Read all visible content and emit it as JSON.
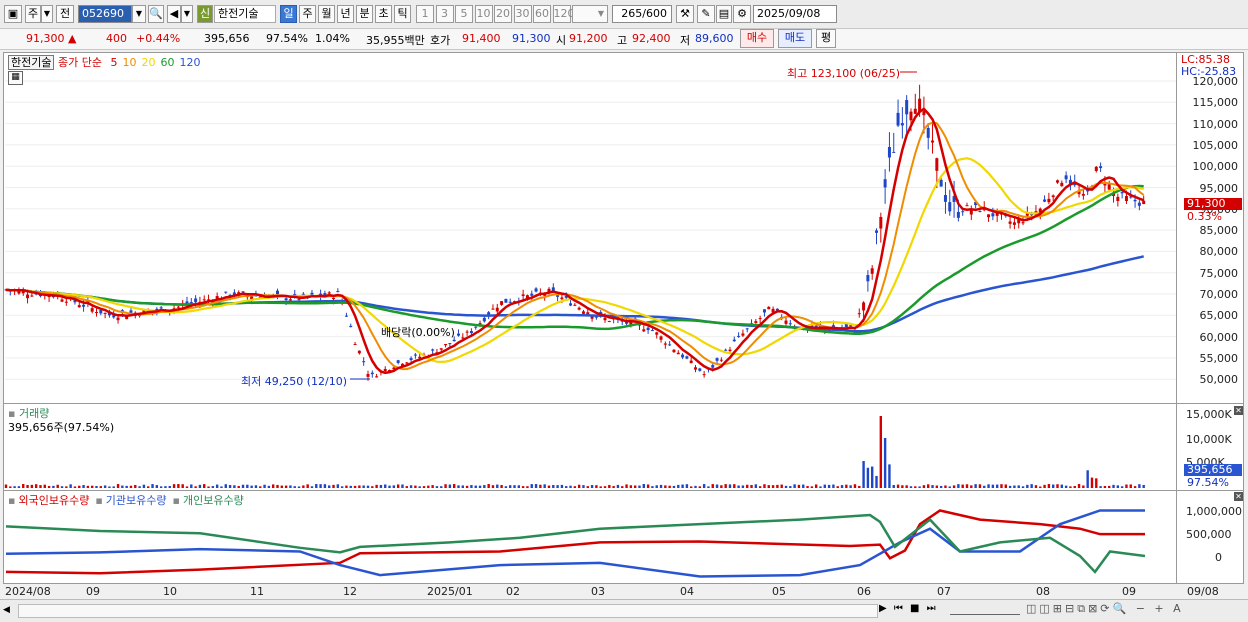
{
  "toolbar": {
    "market_btn": "주",
    "prev_btn": "전",
    "code": "052690",
    "credit_badge": "신",
    "stock_name": "한전기술",
    "periods": [
      "일",
      "주",
      "월",
      "년",
      "분",
      "초",
      "틱"
    ],
    "active_period": "일",
    "intervals": [
      "1",
      "3",
      "5",
      "10",
      "20",
      "30",
      "60",
      "120"
    ],
    "count": "265",
    "count_total": "/600",
    "date": "2025/09/08"
  },
  "quote": {
    "price": "91,300",
    "change": "400",
    "change_pct": "+0.44%",
    "volume": "395,656",
    "volume_ratio": "97.54%",
    "turnover_pct": "1.04%",
    "amount": "35,955백만",
    "ask_label": "호가",
    "ask1": "91,400",
    "bid1": "91,300",
    "open_label": "시",
    "open": "91,200",
    "high_label": "고",
    "high": "92,400",
    "low_label": "저",
    "low": "89,600",
    "buy_btn": "매수",
    "sell_btn": "매도",
    "eval_btn": "평"
  },
  "price_chart": {
    "name_tag": "한전기술",
    "ma_title": "종가 단순",
    "ma_periods": [
      "5",
      "10",
      "20",
      "60",
      "120"
    ],
    "ma_colors": [
      "#d40000",
      "#f08c00",
      "#f0d800",
      "#1a9a2a",
      "#2a55d0"
    ],
    "lc": "LC:85.38",
    "hc": "HC:-25.83",
    "current_price_tag": "91,300",
    "current_pct_tag": "0.33%",
    "high_annot": "최고 123,100 (06/25)",
    "low_annot": "최저 49,250 (12/10)",
    "dividend_annot": "배당락(0.00%)",
    "y_ticks": [
      "120,000",
      "115,000",
      "110,000",
      "105,000",
      "100,000",
      "95,000",
      "90,000",
      "85,000",
      "80,000",
      "75,000",
      "70,000",
      "65,000",
      "60,000",
      "55,000",
      "50,000"
    ]
  },
  "volume_chart": {
    "title": "거래량",
    "value_label": "395,656주(97.54%)",
    "y_ticks": [
      "15,000K",
      "10,000K",
      "5,000K"
    ],
    "current_tag": "395,656",
    "current_pct": "97.54%"
  },
  "holdings_chart": {
    "legend": [
      "외국인보유수량",
      "기관보유수량",
      "개인보유수량"
    ],
    "colors": [
      "#d40000",
      "#2a55d0",
      "#2a8a55"
    ],
    "y_ticks": [
      "1,000,000",
      "500,000",
      "0"
    ]
  },
  "x_axis": {
    "labels": [
      "2024/08",
      "09",
      "10",
      "11",
      "12",
      "2025/01",
      "02",
      "03",
      "04",
      "05",
      "06",
      "07",
      "08",
      "09"
    ],
    "right_label": "09/08"
  }
}
